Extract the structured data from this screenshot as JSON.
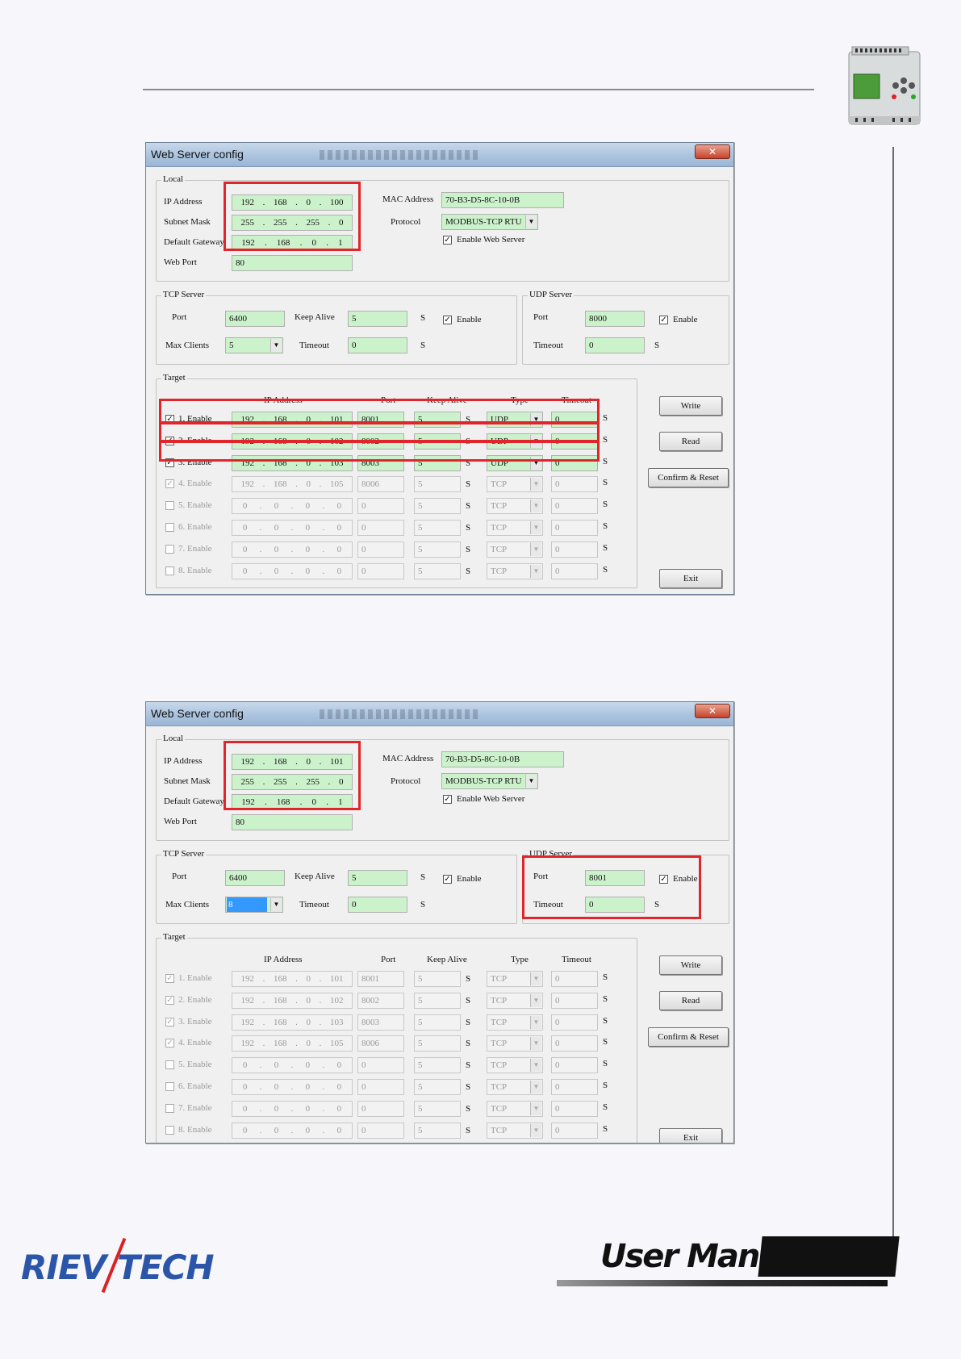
{
  "dialogs": [
    {
      "title": "Web Server config",
      "close_glyph": "✕",
      "local": {
        "group_label": "Local",
        "ip_label": "IP Address",
        "ip": [
          "192",
          "168",
          "0",
          "100"
        ],
        "mask_label": "Subnet Mask",
        "mask": [
          "255",
          "255",
          "255",
          "0"
        ],
        "gw_label": "Default Gateway",
        "gw": [
          "192",
          "168",
          "0",
          "1"
        ],
        "webport_label": "Web Port",
        "webport": "80",
        "mac_label": "MAC Address",
        "mac": "70-B3-D5-8C-10-0B",
        "protocol_label": "Protocol",
        "protocol": "MODBUS-TCP RTU",
        "enable_web_label": "Enable Web Server",
        "enable_web": true
      },
      "tcp": {
        "group_label": "TCP Server",
        "port_label": "Port",
        "port": "6400",
        "keepalive_label": "Keep Alive",
        "keepalive": "5",
        "unit": "S",
        "maxclients_label": "Max Clients",
        "maxclients": "5",
        "timeout_label": "Timeout",
        "timeout": "0",
        "enable_label": "Enable",
        "enable": true
      },
      "udp": {
        "group_label": "UDP Server",
        "port_label": "Port",
        "port": "8000",
        "timeout_label": "Timeout",
        "timeout": "0",
        "unit": "S",
        "enable_label": "Enable",
        "enable": true
      },
      "target": {
        "group_label": "Target",
        "headers": {
          "ip": "IP Address",
          "port": "Port",
          "keepalive": "Keep Alive",
          "type": "Type",
          "timeout": "Timeout"
        },
        "unit": "S",
        "rows": [
          {
            "label": "1. Enable",
            "checked": true,
            "enabled": true,
            "ip": [
              "192",
              "168",
              "0",
              "101"
            ],
            "port": "8001",
            "keepalive": "5",
            "type": "UDP",
            "timeout": "0"
          },
          {
            "label": "2. Enable",
            "checked": true,
            "enabled": true,
            "ip": [
              "192",
              "168",
              "0",
              "102"
            ],
            "port": "8002",
            "keepalive": "5",
            "type": "UDP",
            "timeout": "0"
          },
          {
            "label": "3. Enable",
            "checked": true,
            "enabled": true,
            "ip": [
              "192",
              "168",
              "0",
              "103"
            ],
            "port": "8003",
            "keepalive": "5",
            "type": "UDP",
            "timeout": "0"
          },
          {
            "label": "4. Enable",
            "checked": true,
            "enabled": false,
            "ip": [
              "192",
              "168",
              "0",
              "105"
            ],
            "port": "8006",
            "keepalive": "5",
            "type": "TCP",
            "timeout": "0"
          },
          {
            "label": "5. Enable",
            "checked": false,
            "enabled": false,
            "ip": [
              "0",
              "0",
              "0",
              "0"
            ],
            "port": "0",
            "keepalive": "5",
            "type": "TCP",
            "timeout": "0"
          },
          {
            "label": "6. Enable",
            "checked": false,
            "enabled": false,
            "ip": [
              "0",
              "0",
              "0",
              "0"
            ],
            "port": "0",
            "keepalive": "5",
            "type": "TCP",
            "timeout": "0"
          },
          {
            "label": "7. Enable",
            "checked": false,
            "enabled": false,
            "ip": [
              "0",
              "0",
              "0",
              "0"
            ],
            "port": "0",
            "keepalive": "5",
            "type": "TCP",
            "timeout": "0"
          },
          {
            "label": "8. Enable",
            "checked": false,
            "enabled": false,
            "ip": [
              "0",
              "0",
              "0",
              "0"
            ],
            "port": "0",
            "keepalive": "5",
            "type": "TCP",
            "timeout": "0"
          }
        ]
      },
      "buttons": {
        "write": "Write",
        "read": "Read",
        "confirm": "Confirm & Reset",
        "exit": "Exit"
      }
    },
    {
      "title": "Web Server config",
      "close_glyph": "✕",
      "local": {
        "group_label": "Local",
        "ip_label": "IP Address",
        "ip": [
          "192",
          "168",
          "0",
          "101"
        ],
        "mask_label": "Subnet Mask",
        "mask": [
          "255",
          "255",
          "255",
          "0"
        ],
        "gw_label": "Default Gateway",
        "gw": [
          "192",
          "168",
          "0",
          "1"
        ],
        "webport_label": "Web Port",
        "webport": "80",
        "mac_label": "MAC Address",
        "mac": "70-B3-D5-8C-10-0B",
        "protocol_label": "Protocol",
        "protocol": "MODBUS-TCP RTU",
        "enable_web_label": "Enable Web Server",
        "enable_web": true
      },
      "tcp": {
        "group_label": "TCP Server",
        "port_label": "Port",
        "port": "6400",
        "keepalive_label": "Keep Alive",
        "keepalive": "5",
        "unit": "S",
        "maxclients_label": "Max Clients",
        "maxclients": "8",
        "timeout_label": "Timeout",
        "timeout": "0",
        "enable_label": "Enable",
        "enable": true
      },
      "udp": {
        "group_label": "UDP Server",
        "port_label": "Port",
        "port": "8001",
        "timeout_label": "Timeout",
        "timeout": "0",
        "unit": "S",
        "enable_label": "Enable",
        "enable": true
      },
      "target": {
        "group_label": "Target",
        "headers": {
          "ip": "IP Address",
          "port": "Port",
          "keepalive": "Keep Alive",
          "type": "Type",
          "timeout": "Timeout"
        },
        "unit": "S",
        "rows": [
          {
            "label": "1. Enable",
            "checked": true,
            "enabled": false,
            "ip": [
              "192",
              "168",
              "0",
              "101"
            ],
            "port": "8001",
            "keepalive": "5",
            "type": "TCP",
            "timeout": "0"
          },
          {
            "label": "2. Enable",
            "checked": true,
            "enabled": false,
            "ip": [
              "192",
              "168",
              "0",
              "102"
            ],
            "port": "8002",
            "keepalive": "5",
            "type": "TCP",
            "timeout": "0"
          },
          {
            "label": "3. Enable",
            "checked": true,
            "enabled": false,
            "ip": [
              "192",
              "168",
              "0",
              "103"
            ],
            "port": "8003",
            "keepalive": "5",
            "type": "TCP",
            "timeout": "0"
          },
          {
            "label": "4. Enable",
            "checked": true,
            "enabled": false,
            "ip": [
              "192",
              "168",
              "0",
              "105"
            ],
            "port": "8006",
            "keepalive": "5",
            "type": "TCP",
            "timeout": "0"
          },
          {
            "label": "5. Enable",
            "checked": false,
            "enabled": false,
            "ip": [
              "0",
              "0",
              "0",
              "0"
            ],
            "port": "0",
            "keepalive": "5",
            "type": "TCP",
            "timeout": "0"
          },
          {
            "label": "6. Enable",
            "checked": false,
            "enabled": false,
            "ip": [
              "0",
              "0",
              "0",
              "0"
            ],
            "port": "0",
            "keepalive": "5",
            "type": "TCP",
            "timeout": "0"
          },
          {
            "label": "7. Enable",
            "checked": false,
            "enabled": false,
            "ip": [
              "0",
              "0",
              "0",
              "0"
            ],
            "port": "0",
            "keepalive": "5",
            "type": "TCP",
            "timeout": "0"
          },
          {
            "label": "8. Enable",
            "checked": false,
            "enabled": false,
            "ip": [
              "0",
              "0",
              "0",
              "0"
            ],
            "port": "0",
            "keepalive": "5",
            "type": "TCP",
            "timeout": "0"
          }
        ]
      },
      "buttons": {
        "write": "Write",
        "read": "Read",
        "confirm": "Confirm & Reset",
        "exit": "Exit"
      }
    }
  ],
  "footer": {
    "logo_left": "RIEV",
    "logo_right": "TECH",
    "manual_label": "User Manual"
  },
  "colors": {
    "field_green": "#ccf2cc",
    "highlight_red": "#e0262b",
    "logo_blue": "#2a55a8",
    "logo_red": "#d92323"
  }
}
